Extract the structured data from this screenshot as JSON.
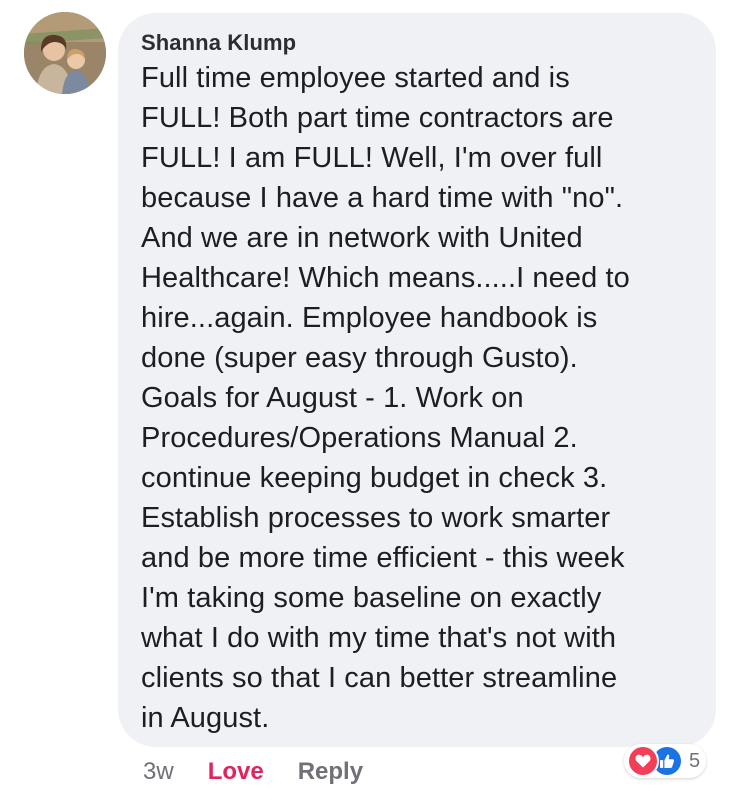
{
  "comment": {
    "author": "Shanna Klump",
    "text": "Full time employee started and is\nFULL!  Both part time contractors are\nFULL! I am FULL!  Well, I'm over full\nbecause I have a hard time with \"no\".\nAnd we are in network with United\nHealthcare!  Which means.....I need to\nhire...again. Employee handbook is\ndone (super easy through Gusto).\nGoals for August - 1. Work on\nProcedures/Operations Manual 2.\ncontinue keeping budget in check 3.\nEstablish processes to work smarter\nand be more time efficient - this week\nI'm taking some baseline on exactly\nwhat I do with my time that's not with\nclients so that I can better streamline\nin August.",
    "timestamp": "3w",
    "love_label": "Love",
    "reply_label": "Reply"
  },
  "reactions": {
    "icons": [
      "heart-icon",
      "thumbs-up-icon"
    ],
    "count": "5"
  },
  "colors": {
    "bubble_bg": "#f0f1f4",
    "love": "#e0245e",
    "heart": "#f33e58",
    "like": "#1b74e4",
    "muted": "#6f7176"
  }
}
